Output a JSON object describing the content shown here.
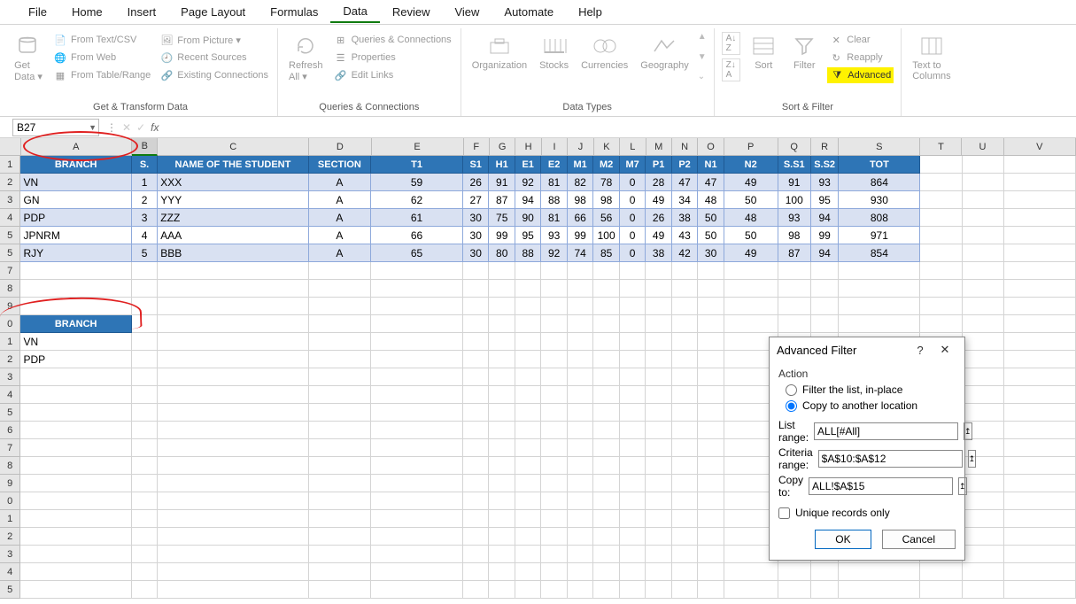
{
  "menu": [
    "File",
    "Home",
    "Insert",
    "Page Layout",
    "Formulas",
    "Data",
    "Review",
    "View",
    "Automate",
    "Help"
  ],
  "active_menu_index": 5,
  "ribbon": {
    "groups": [
      {
        "label": "Get & Transform Data",
        "big": [
          "Get\nData"
        ],
        "smalls": [
          [
            "From Text/CSV",
            "From Web",
            "From Table/Range"
          ],
          [
            "From Picture",
            "Recent Sources",
            "Existing Connections"
          ]
        ]
      },
      {
        "label": "Queries & Connections",
        "big": [
          "Refresh\nAll"
        ],
        "smalls": [
          [
            "Queries & Connections",
            "Properties",
            "Edit Links"
          ]
        ]
      },
      {
        "label": "Data Types",
        "bigs": [
          "Organization",
          "Stocks",
          "Currencies",
          "Geography"
        ]
      },
      {
        "label": "Sort & Filter",
        "bigs": [
          "",
          "Sort",
          "Filter"
        ],
        "smalls": [
          [
            "Clear",
            "Reapply",
            "Advanced"
          ]
        ]
      },
      {
        "label": "",
        "bigs": [
          "Text to\nColumns"
        ]
      }
    ]
  },
  "namebox": "B27",
  "columns": [
    "A",
    "B",
    "C",
    "D",
    "E",
    "F",
    "G",
    "H",
    "I",
    "J",
    "K",
    "L",
    "M",
    "N",
    "O",
    "P",
    "Q",
    "R",
    "S",
    "T",
    "U",
    "V"
  ],
  "header_row": [
    "BRANCH",
    "S.",
    "NAME OF THE STUDENT",
    "SECTION",
    "T1",
    "S1",
    "H1",
    "E1",
    "E2",
    "M1",
    "M2",
    "M7",
    "P1",
    "P2",
    "N1",
    "N2",
    "S.S1",
    "S.S2",
    "TOT"
  ],
  "data_rows": [
    [
      "VN",
      "1",
      "XXX",
      "A",
      "59",
      "26",
      "91",
      "92",
      "81",
      "82",
      "78",
      "0",
      "28",
      "47",
      "47",
      "49",
      "91",
      "93",
      "864"
    ],
    [
      "GN",
      "2",
      "YYY",
      "A",
      "62",
      "27",
      "87",
      "94",
      "88",
      "98",
      "98",
      "0",
      "49",
      "34",
      "48",
      "50",
      "100",
      "95",
      "930"
    ],
    [
      "PDP",
      "3",
      "ZZZ",
      "A",
      "61",
      "30",
      "75",
      "90",
      "81",
      "66",
      "56",
      "0",
      "26",
      "38",
      "50",
      "48",
      "93",
      "94",
      "808"
    ],
    [
      "JPNRM",
      "4",
      "AAA",
      "A",
      "66",
      "30",
      "99",
      "95",
      "93",
      "99",
      "100",
      "0",
      "49",
      "43",
      "50",
      "50",
      "98",
      "99",
      "971"
    ],
    [
      "RJY",
      "5",
      "BBB",
      "A",
      "65",
      "30",
      "80",
      "88",
      "92",
      "74",
      "85",
      "0",
      "38",
      "42",
      "30",
      "49",
      "87",
      "94",
      "854"
    ]
  ],
  "criteria_header": "BRANCH",
  "criteria_rows": [
    "VN",
    "PDP"
  ],
  "visible_row_numbers": [
    "1",
    "2",
    "3",
    "4",
    "5",
    "5",
    "7",
    "8",
    "9",
    "0",
    "1",
    "2",
    "3",
    "4",
    "5",
    "6",
    "7",
    "8",
    "9",
    "0",
    "1",
    "2",
    "3",
    "4",
    "5"
  ],
  "dialog": {
    "title": "Advanced Filter",
    "action_label": "Action",
    "radio1": "Filter the list, in-place",
    "radio2": "Copy to another location",
    "list_range_label": "List range:",
    "list_range_value": "ALL[#All]",
    "criteria_range_label": "Criteria range:",
    "criteria_range_value": "$A$10:$A$12",
    "copy_to_label": "Copy to:",
    "copy_to_value": "ALL!$A$15",
    "unique_label": "Unique records only",
    "ok": "OK",
    "cancel": "Cancel"
  }
}
